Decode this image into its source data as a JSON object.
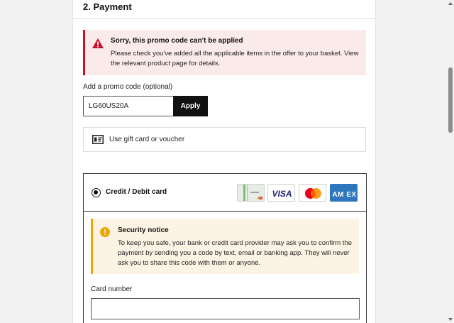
{
  "section": {
    "title": "2. Payment"
  },
  "promo_error": {
    "icon": "warning-triangle-icon",
    "title": "Sorry, this promo code can't be applied",
    "body": "Please check you've added all the applicable items in the offer to your basket. View the relevant product page for details.",
    "accent_color": "#c8102e"
  },
  "promo": {
    "label": "Add a promo code (optional)",
    "value": "LG60US20A",
    "apply_label": "Apply"
  },
  "gift_card": {
    "icon": "gift-card-icon",
    "label": "Use gift card or voucher"
  },
  "payment_method": {
    "label": "Credit / Debit card",
    "selected": true,
    "logos": [
      "gift-card-logo",
      "visa-logo",
      "mastercard-logo",
      "amex-logo"
    ],
    "logo_text": {
      "visa": "VISA",
      "amex": "AM EX"
    }
  },
  "security_notice": {
    "icon": "info-exclamation-icon",
    "title": "Security notice",
    "body": "To keep you safe, your bank or credit card provider may ask you to confirm the payment by sending you a code by text, email or banking app. They will never ask you to share this code with them or anyone.",
    "accent_color": "#f0a500"
  },
  "card_number": {
    "label": "Card number",
    "value": ""
  }
}
